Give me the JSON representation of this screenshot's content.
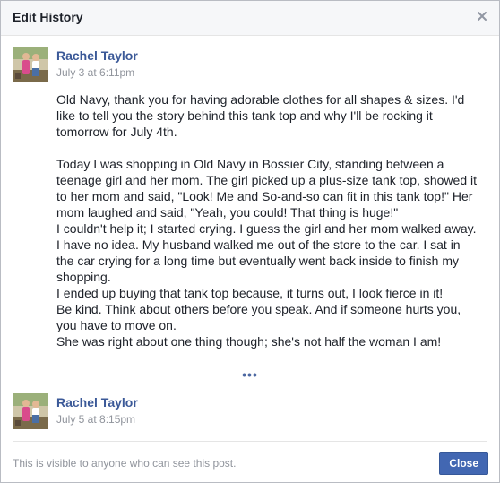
{
  "dialog": {
    "title": "Edit History",
    "close_icon": "close-icon"
  },
  "entries": [
    {
      "author": "Rachel Taylor",
      "timestamp": "July 3 at 6:11pm",
      "text": "Old Navy, thank you for having adorable clothes for all shapes & sizes. I'd like to tell you the story behind this tank top and why I'll be rocking it tomorrow for July 4th.\n\nToday I was shopping in Old Navy in Bossier City, standing between a teenage girl and her mom. The girl picked up a plus-size tank top, showed it to her mom and said, \"Look! Me and So-and-so can fit in this tank top!\" Her mom laughed and said, \"Yeah, you could! That thing is huge!\"\nI couldn't help it; I started crying. I guess the girl and her mom walked away. I have no idea. My husband walked me out of the store to the car. I sat in the car crying for a long time but eventually went back inside to finish my shopping.\nI ended up buying that tank top because, it turns out, I look fierce in it!\nBe kind. Think about others before you speak. And if someone hurts you, you have to move on.\nShe was right about one thing though; she's not half the woman I am!"
    },
    {
      "author": "Rachel Taylor",
      "timestamp": "July 5 at 8:15pm"
    }
  ],
  "more_indicator": "•••",
  "footer": {
    "visibility_text": "This is visible to anyone who can see this post.",
    "close_label": "Close"
  },
  "colors": {
    "link": "#3b5998",
    "button": "#4267b2",
    "header_bg": "#f6f7f9"
  }
}
